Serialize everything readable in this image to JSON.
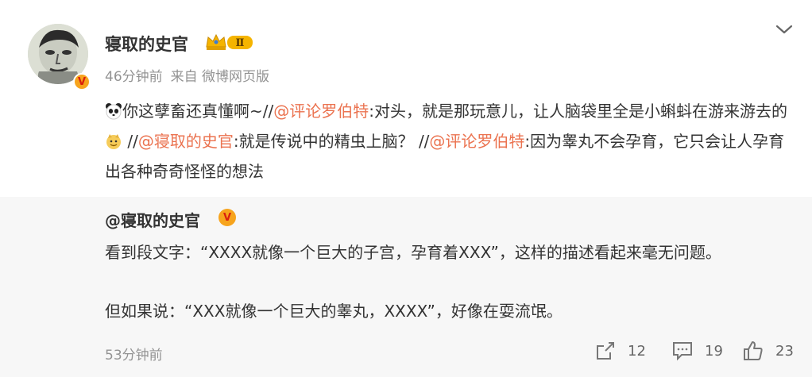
{
  "post": {
    "username": "寝取的史官",
    "level_badge": "Ⅱ",
    "time": "46分钟前",
    "source": "来自 微博网页版",
    "segments": {
      "s1": "你这孽畜还真懂啊~//",
      "m1": "@评论罗伯特",
      "s2": ":对头，就是那玩意儿，让人脑袋里全是小蝌蚪在游来游去的",
      "s3": " //",
      "m2": "@寝取的史官",
      "s4": ":就是传说中的精虫上脑？ //",
      "m3": "@评论罗伯特",
      "s5": ":因为睾丸不会孕育，它只会让人孕育出各种奇奇怪怪的想法"
    }
  },
  "retweet": {
    "username": "@寝取的史官",
    "para1": "看到段文字：“XXXX就像一个巨大的子宫，孕育着XXX”，这样的描述看起来毫无问题。",
    "para2": "但如果说：“XXX就像一个巨大的睾丸，XXXX”，好像在耍流氓。",
    "time": "53分钟前",
    "actions": {
      "repost_count": "12",
      "comment_count": "19",
      "like_count": "23"
    }
  },
  "icons": [
    "panda-emoji-icon",
    "doge-emoji-icon",
    "verified-v-icon",
    "crown-level-badge-icon",
    "chevron-down-icon",
    "repost-icon",
    "comment-icon",
    "like-icon"
  ],
  "colors": {
    "mention": "#eb7350",
    "badge_orange": "#f7a41d",
    "meta_gray": "#939393",
    "retweet_bg": "#f7f7f7"
  }
}
